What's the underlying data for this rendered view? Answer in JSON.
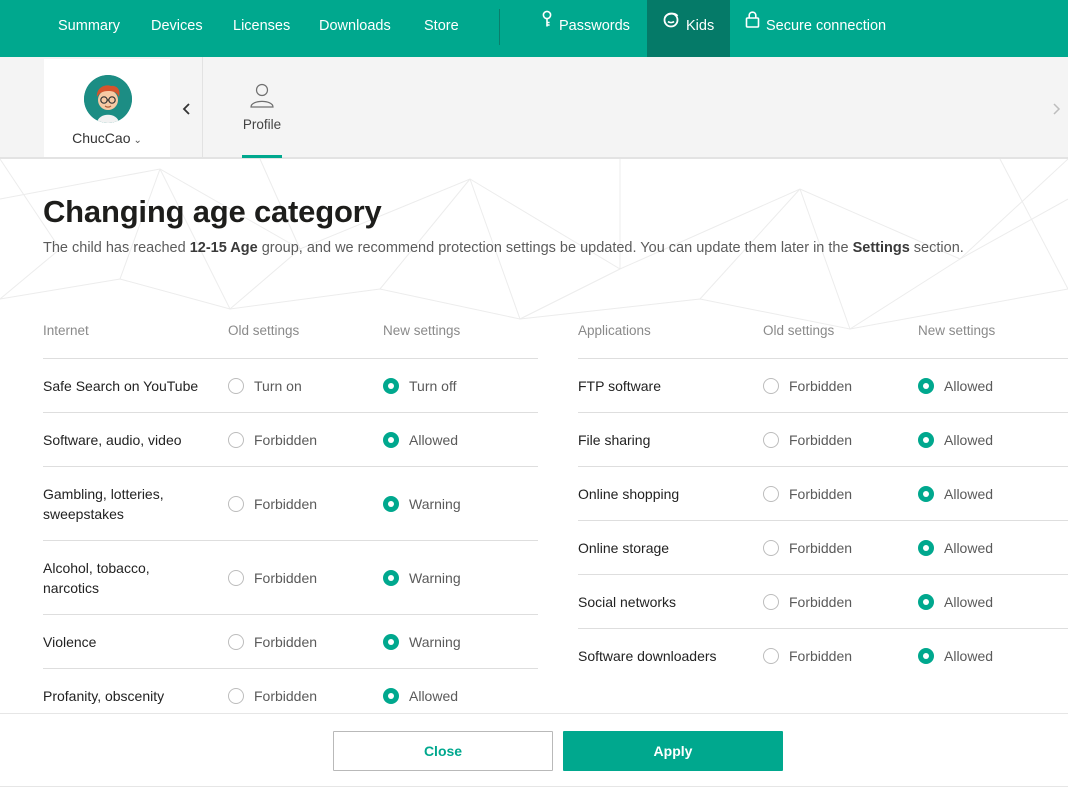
{
  "nav": {
    "items": [
      "Summary",
      "Devices",
      "Licenses",
      "Downloads",
      "Store"
    ],
    "passwords": "Passwords",
    "kids": "Kids",
    "secure": "Secure connection"
  },
  "colors": {
    "accent": "#00a88e",
    "accent_dark": "#057a68"
  },
  "child": {
    "name": "ChucCao"
  },
  "tabs": {
    "profile": "Profile"
  },
  "page": {
    "title": "Changing age category",
    "desc_1": "The child has reached ",
    "desc_age": "12-15 Age",
    "desc_2": " group, and we recommend protection settings be updated. You can update them later in the ",
    "desc_settings": "Settings",
    "desc_3": " section."
  },
  "internet": {
    "header": "Internet",
    "old_header": "Old settings",
    "new_header": "New settings",
    "rows": [
      {
        "name": "Safe Search on YouTube",
        "old": "Turn on",
        "new": "Turn off"
      },
      {
        "name": "Software, audio, video",
        "old": "Forbidden",
        "new": "Allowed"
      },
      {
        "name": "Gambling, lotteries, sweepstakes",
        "old": "Forbidden",
        "new": "Warning"
      },
      {
        "name": "Alcohol, tobacco, narcotics",
        "old": "Forbidden",
        "new": "Warning"
      },
      {
        "name": "Violence",
        "old": "Forbidden",
        "new": "Warning"
      },
      {
        "name": "Profanity, obscenity",
        "old": "Forbidden",
        "new": "Allowed"
      }
    ]
  },
  "applications": {
    "header": "Applications",
    "old_header": "Old settings",
    "new_header": "New settings",
    "rows": [
      {
        "name": "FTP software",
        "old": "Forbidden",
        "new": "Allowed"
      },
      {
        "name": "File sharing",
        "old": "Forbidden",
        "new": "Allowed"
      },
      {
        "name": "Online shopping",
        "old": "Forbidden",
        "new": "Allowed"
      },
      {
        "name": "Online storage",
        "old": "Forbidden",
        "new": "Allowed"
      },
      {
        "name": "Social networks",
        "old": "Forbidden",
        "new": "Allowed"
      },
      {
        "name": "Software downloaders",
        "old": "Forbidden",
        "new": "Allowed"
      }
    ]
  },
  "footer": {
    "close": "Close",
    "apply": "Apply"
  }
}
